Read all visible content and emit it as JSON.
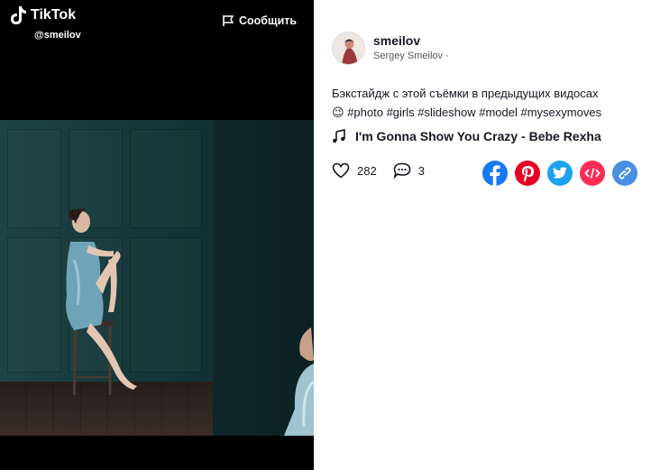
{
  "video": {
    "logo_text": "TikTok",
    "username": "@smeilov",
    "report_label": "Сообщить"
  },
  "author": {
    "handle": "smeilov",
    "name": "Sergey Smeilov ·"
  },
  "description": {
    "text": "Бэкстайдж с этой съёмки в предыдущих видосах",
    "emoji": "😉",
    "hashtags": [
      "#photo",
      "#girls",
      "#slideshow",
      "#model",
      "#mysexymoves"
    ]
  },
  "music": {
    "title": "I'm Gonna Show You Crazy - Bebe Rexha"
  },
  "stats": {
    "likes": "282",
    "comments": "3"
  },
  "share": {
    "facebook_color": "#1877f2",
    "pinterest_color": "#e60023",
    "twitter_color": "#1da1f2",
    "embed_color": "#fe2c55",
    "link_color": "#4a90e2"
  }
}
